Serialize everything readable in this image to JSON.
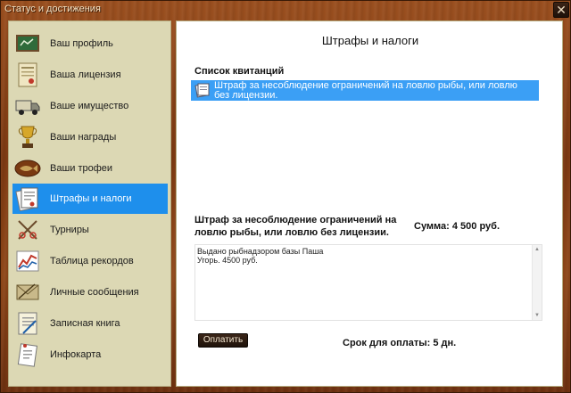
{
  "window": {
    "title": "Статус и достижения",
    "close_glyph": "✕"
  },
  "sidebar": {
    "items": [
      {
        "label": "Ваш профиль",
        "icon": "chalkboard-icon"
      },
      {
        "label": "Ваша лицензия",
        "icon": "certificate-icon"
      },
      {
        "label": "Ваше имущество",
        "icon": "truck-icon"
      },
      {
        "label": "Ваши награды",
        "icon": "trophy-icon"
      },
      {
        "label": "Ваши трофеи",
        "icon": "fish-plaque-icon"
      },
      {
        "label": "Штрафы и налоги",
        "icon": "fine-document-icon"
      },
      {
        "label": "Турниры",
        "icon": "crossed-rods-icon"
      },
      {
        "label": "Таблица рекордов",
        "icon": "chart-icon"
      },
      {
        "label": "Личные сообщения",
        "icon": "envelope-icon"
      },
      {
        "label": "Записная книга",
        "icon": "notebook-icon"
      },
      {
        "label": "Инфокарта",
        "icon": "info-card-icon"
      }
    ],
    "active_index": 5
  },
  "main": {
    "title": "Штрафы и налоги",
    "receipts_label": "Список квитанций",
    "receipts": [
      {
        "text": "Штраф за несоблюдение ограничений на ловлю рыбы, или ловлю без лицензии.",
        "selected": true
      }
    ],
    "detail": {
      "title": "Штраф за несоблюдение ограничений на ловлю рыбы, или ловлю без лицензии.",
      "sum": "Сумма: 4 500 руб.",
      "description_line1": "Выдано рыбнадзором базы Паша",
      "description_line2": "Угорь. 4500 руб."
    },
    "pay_button": "Оплатить",
    "deadline": "Срок для оплаты: 5 дн."
  },
  "colors": {
    "active_item": "#1e8fec",
    "selected_row": "#3b9ff5",
    "sidebar_bg": "#dcd8b4",
    "wood": "#8e4719"
  }
}
